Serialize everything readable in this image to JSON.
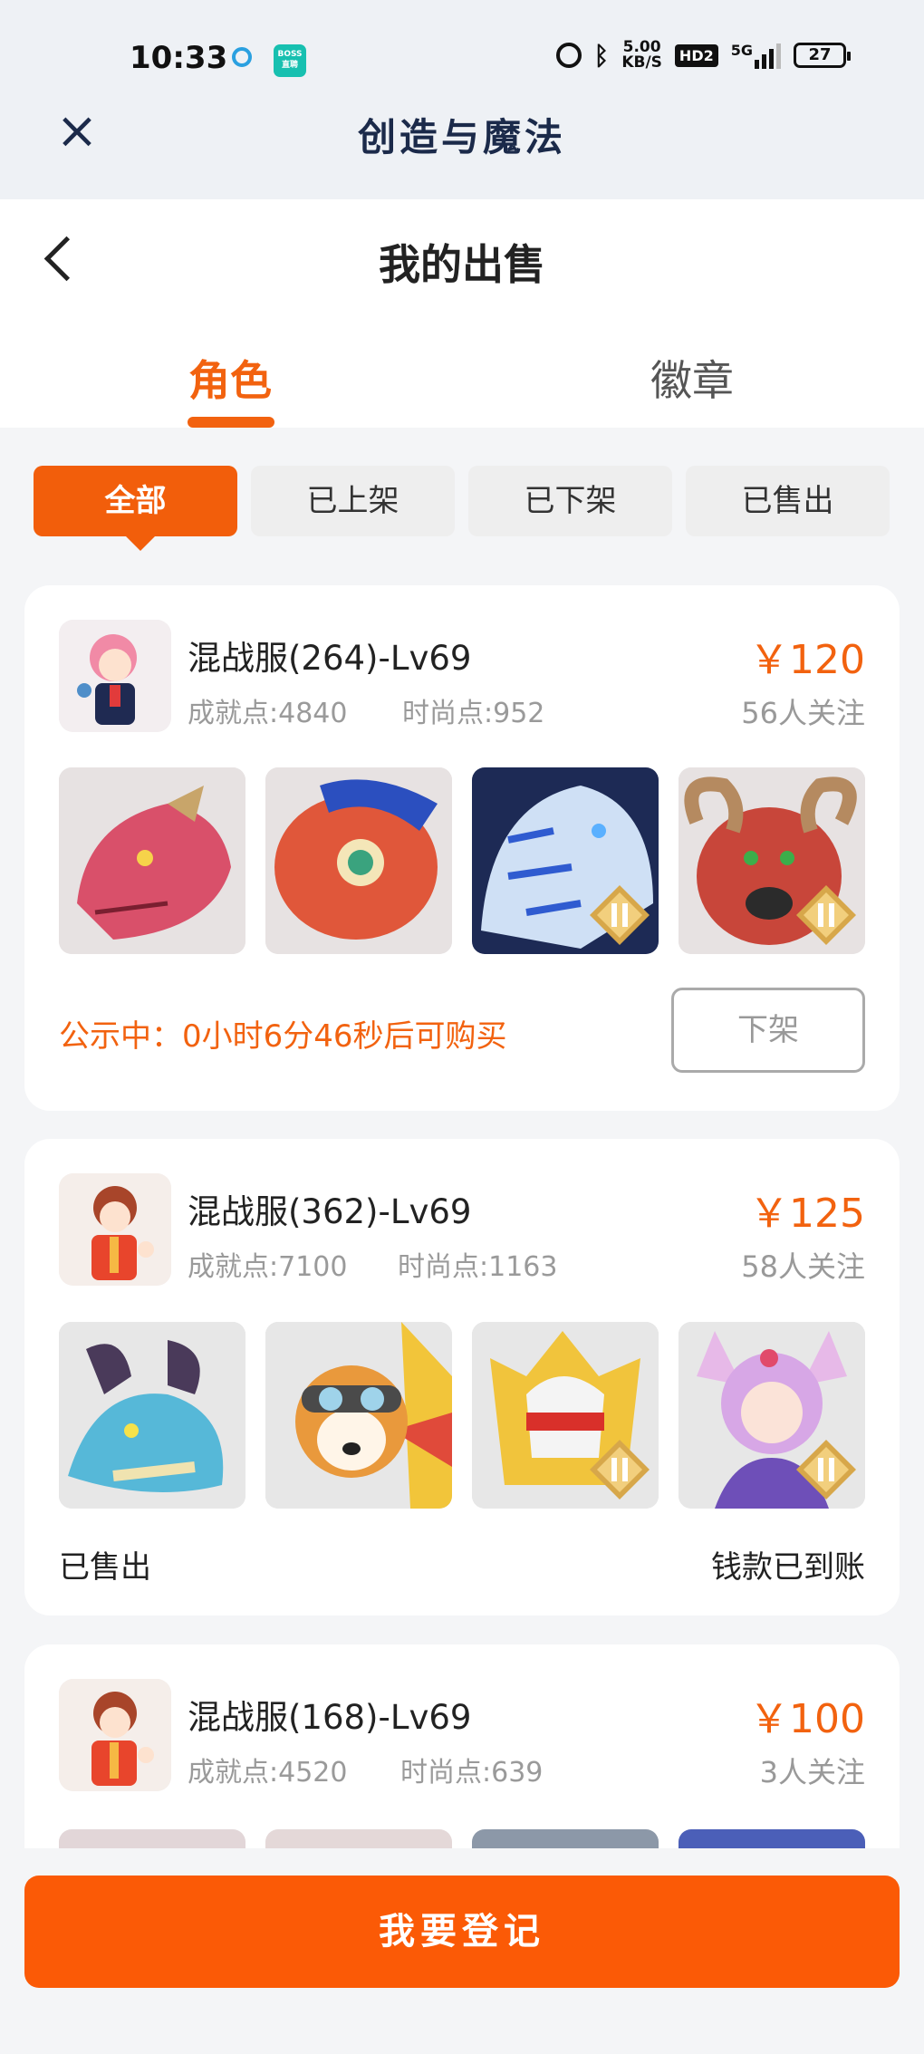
{
  "status_bar": {
    "time": "10:33",
    "boss_label": "BOSS\n直聘",
    "net_speed_value": "5.00",
    "net_speed_unit": "KB/S",
    "hd_label": "HD2",
    "signal_label": "5G",
    "battery": "27"
  },
  "app": {
    "title": "创造与魔法",
    "close_icon": "close-icon"
  },
  "page": {
    "title": "我的出售",
    "back_icon": "chevron-left-icon"
  },
  "tabs": [
    {
      "label": "角色",
      "active": true
    },
    {
      "label": "徽章",
      "active": false
    }
  ],
  "filters": [
    {
      "label": "全部",
      "active": true
    },
    {
      "label": "已上架",
      "active": false
    },
    {
      "label": "已下架",
      "active": false
    },
    {
      "label": "已售出",
      "active": false
    }
  ],
  "listings": [
    {
      "server": "混战服(264)-Lv69",
      "achievement": "成就点:4840",
      "fashion": "时尚点:952",
      "price": "￥120",
      "followers": "56人关注",
      "thumbnails": [
        "red-dragon-mount",
        "red-fish-mount",
        "blue-tiger-mount",
        "red-ram-mount"
      ],
      "status_text": "公示中：0小时6分46秒后可购买",
      "action_label": "下架"
    },
    {
      "server": "混战服(362)-Lv69",
      "achievement": "成就点:7100",
      "fashion": "时尚点:1163",
      "price": "￥125",
      "followers": "58人关注",
      "thumbnails": [
        "teal-dragon-mount",
        "corgi-pilot-pet",
        "golden-armor-pet",
        "fox-spirit-pet"
      ],
      "status_text": "已售出",
      "payment_text": "钱款已到账"
    },
    {
      "server": "混战服(168)-Lv69",
      "achievement": "成就点:4520",
      "fashion": "时尚点:639",
      "price": "￥100",
      "followers": "3人关注"
    }
  ],
  "footer": {
    "register_label": "我要登记"
  },
  "colors": {
    "accent": "#f2620f",
    "button": "#fb5a06",
    "background": "#f4f5f7"
  }
}
